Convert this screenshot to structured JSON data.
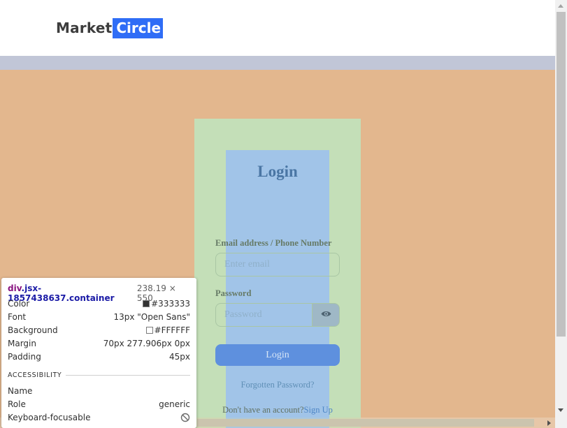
{
  "logo": {
    "part1": "Market",
    "part2": "Circle"
  },
  "form": {
    "title": "Login",
    "email_label": "Email address / Phone Number",
    "email_placeholder": "Enter email",
    "password_label": "Password",
    "password_placeholder": "Password",
    "submit_label": "Login",
    "forgot_link": "Forgotten Password?",
    "signup_prompt": "Don't have an account?",
    "signup_link": "Sign Up"
  },
  "inspector": {
    "selector_tag": "div",
    "selector_class": ".jsx-1857438637.container",
    "size": "238.19 × 550",
    "rows": [
      {
        "label": "Color",
        "value": "#333333",
        "swatch": "#333333"
      },
      {
        "label": "Font",
        "value": "13px \"Open Sans\""
      },
      {
        "label": "Background",
        "value": "#FFFFFF",
        "swatch": "#FFFFFF"
      },
      {
        "label": "Margin",
        "value": "70px 277.906px 0px"
      },
      {
        "label": "Padding",
        "value": "45px"
      }
    ],
    "section_title": "ACCESSIBILITY",
    "accessibility": [
      {
        "label": "Name",
        "value": ""
      },
      {
        "label": "Role",
        "value": "generic"
      },
      {
        "label": "Keyboard-focusable",
        "value_icon": "not-allowed-icon"
      }
    ]
  },
  "colors": {
    "brand_blue": "#2f6df6",
    "margin_overlay": "#e3b78e",
    "padding_overlay": "#c4dfb8",
    "content_overlay": "#a1c4e8"
  }
}
